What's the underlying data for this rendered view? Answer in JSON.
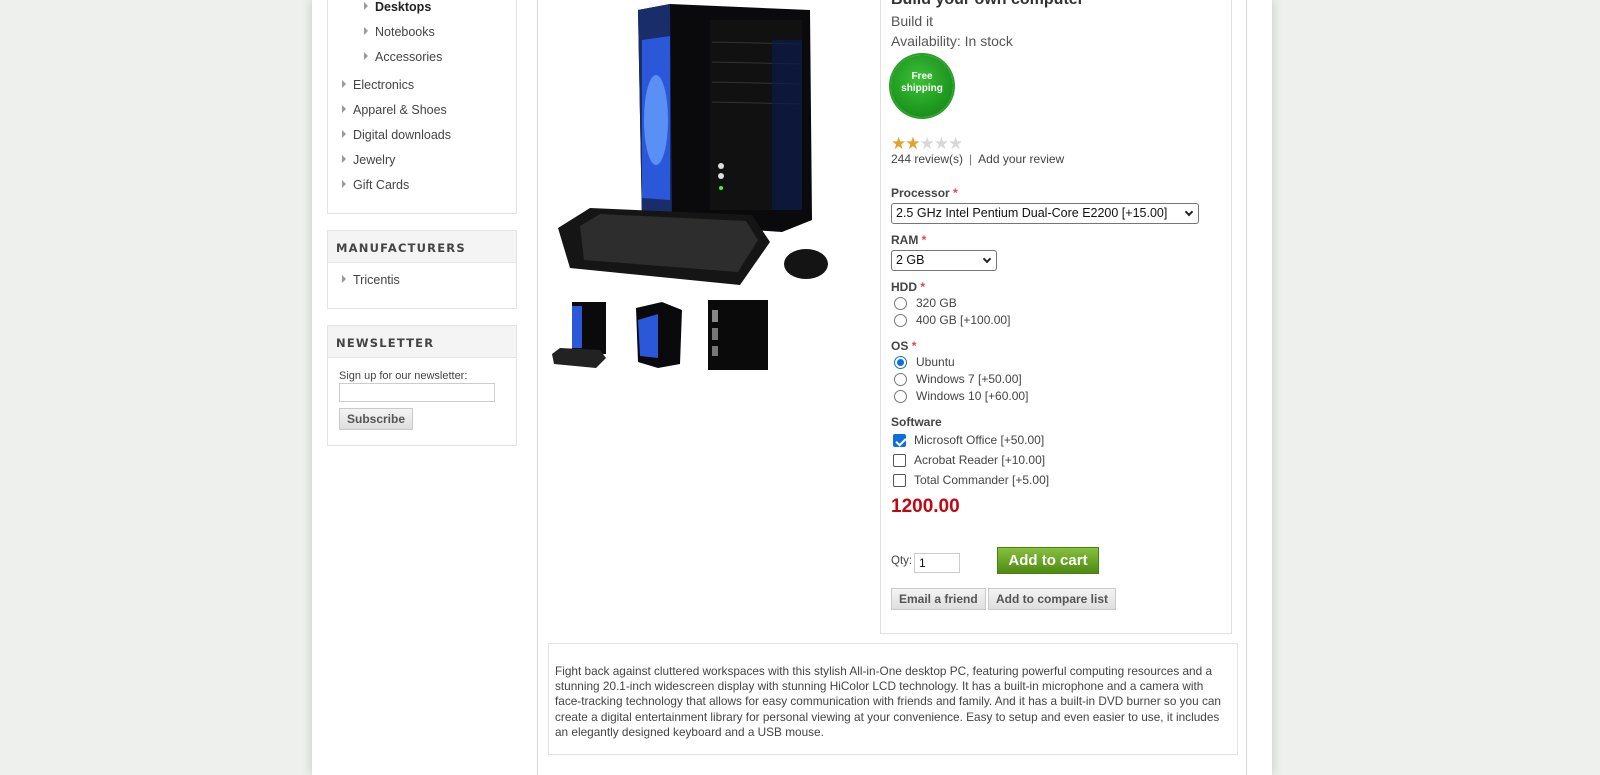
{
  "sidebar": {
    "categories": {
      "sub_items": [
        {
          "label": "Desktops",
          "active": true
        },
        {
          "label": "Notebooks",
          "active": false
        },
        {
          "label": "Accessories",
          "active": false
        }
      ],
      "items": [
        "Electronics",
        "Apparel & Shoes",
        "Digital downloads",
        "Jewelry",
        "Gift Cards"
      ]
    },
    "manufacturers": {
      "title": "MANUFACTURERS",
      "items": [
        "Tricentis"
      ]
    },
    "newsletter": {
      "title": "NEWSLETTER",
      "label": "Sign up for our newsletter:",
      "email_value": "",
      "subscribe_label": "Subscribe"
    }
  },
  "product": {
    "name": "Build your own computer",
    "short_description": "Build it",
    "availability_label": "Availability:",
    "availability_value": "In stock",
    "free_shipping_badge": "Free\nshipping",
    "rating": {
      "stars": 2,
      "max": 5
    },
    "reviews_count": "244 review(s)",
    "add_review_label": "Add your review",
    "attributes": {
      "processor": {
        "label": "Processor",
        "required": "*",
        "selected": "2.5 GHz Intel Pentium Dual-Core E2200 [+15.00]"
      },
      "ram": {
        "label": "RAM",
        "required": "*",
        "selected": "2 GB"
      },
      "hdd": {
        "label": "HDD",
        "required": "*",
        "options": [
          {
            "label": "320 GB",
            "checked": false
          },
          {
            "label": "400 GB [+100.00]",
            "checked": false
          }
        ]
      },
      "os": {
        "label": "OS",
        "required": "*",
        "options": [
          {
            "label": "Ubuntu",
            "checked": true
          },
          {
            "label": "Windows 7 [+50.00]",
            "checked": false
          },
          {
            "label": "Windows 10 [+60.00]",
            "checked": false
          }
        ]
      },
      "software": {
        "label": "Software",
        "options": [
          {
            "label": "Microsoft Office [+50.00]",
            "checked": true
          },
          {
            "label": "Acrobat Reader [+10.00]",
            "checked": false
          },
          {
            "label": "Total Commander [+5.00]",
            "checked": false
          }
        ]
      }
    },
    "price": "1200.00",
    "qty_label": "Qty:",
    "qty_value": "1",
    "add_to_cart_label": "Add to cart",
    "email_friend_label": "Email a friend",
    "compare_label": "Add to compare list",
    "full_description": "Fight back against cluttered workspaces with this stylish All-in-One desktop PC, featuring powerful computing resources and a stunning 20.1-inch widescreen display with stunning HiColor LCD technology. It has a built-in microphone and a camera with face-tracking technology that allows for easy communication with friends and family. And it has a built-in DVD burner so you can create a digital entertainment library for personal viewing at your convenience. Easy to setup and even easier to use, it includes an elegantly designed keyboard and a USB mouse."
  },
  "colors": {
    "price": "#c2070f",
    "add_to_cart": "#5a9a1c",
    "required_marker": "#e4434b",
    "checked_control": "#0e6fdc",
    "free_shipping": "#1e9a1f"
  },
  "icons": {
    "nav_arrow": "triangle-right-icon",
    "select_arrow": "chevron-down-icon",
    "rating": "star-icon"
  }
}
